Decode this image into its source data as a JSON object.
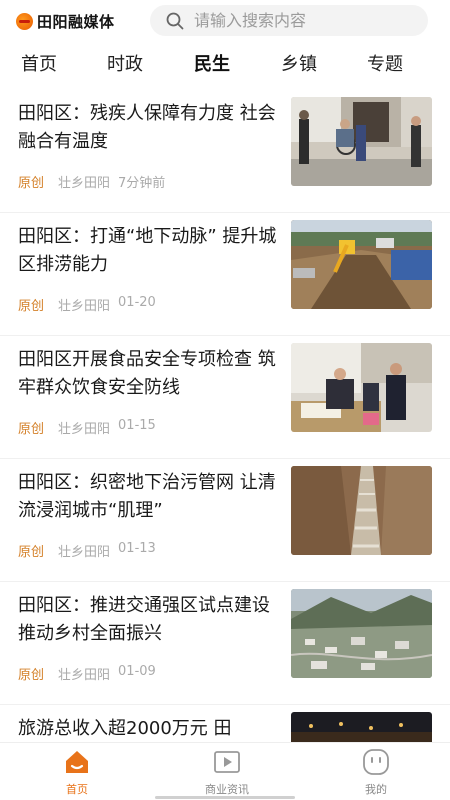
{
  "header": {
    "app_name": "田阳融媒体",
    "search_placeholder": "请输入搜索内容"
  },
  "tabs": [
    {
      "label": "首页"
    },
    {
      "label": "时政"
    },
    {
      "label": "民生",
      "active": true
    },
    {
      "label": "乡镇"
    },
    {
      "label": "专题"
    }
  ],
  "articles": [
    {
      "title": "田阳区：残疾人保障有力度 社会融合有温度",
      "tag": "原创",
      "source": "壮乡田阳",
      "time": "7分钟前"
    },
    {
      "title": "田阳区：打通“地下动脉” 提升城区排涝能力",
      "tag": "原创",
      "source": "壮乡田阳",
      "time": "01-20"
    },
    {
      "title": "田阳区开展食品安全专项检查  筑牢群众饮食安全防线",
      "tag": "原创",
      "source": "壮乡田阳",
      "time": "01-15"
    },
    {
      "title": "田阳区：织密地下治污管网 让清流浸润城市“肌理”",
      "tag": "原创",
      "source": "壮乡田阳",
      "time": "01-13"
    },
    {
      "title": "田阳区：推进交通强区试点建设  推动乡村全面振兴",
      "tag": "原创",
      "source": "壮乡田阳",
      "time": "01-09"
    },
    {
      "title": "旅游总收入超2000万元  田"
    }
  ],
  "bottom_nav": [
    {
      "label": "首页",
      "icon": "home-icon",
      "active": true
    },
    {
      "label": "商业资讯",
      "icon": "video-play-icon"
    },
    {
      "label": "我的",
      "icon": "profile-face-icon"
    }
  ],
  "colors": {
    "accent": "#e8731a",
    "tag": "#d4812a",
    "meta": "#aaaaaa",
    "search_bg": "#f3f3f3"
  }
}
